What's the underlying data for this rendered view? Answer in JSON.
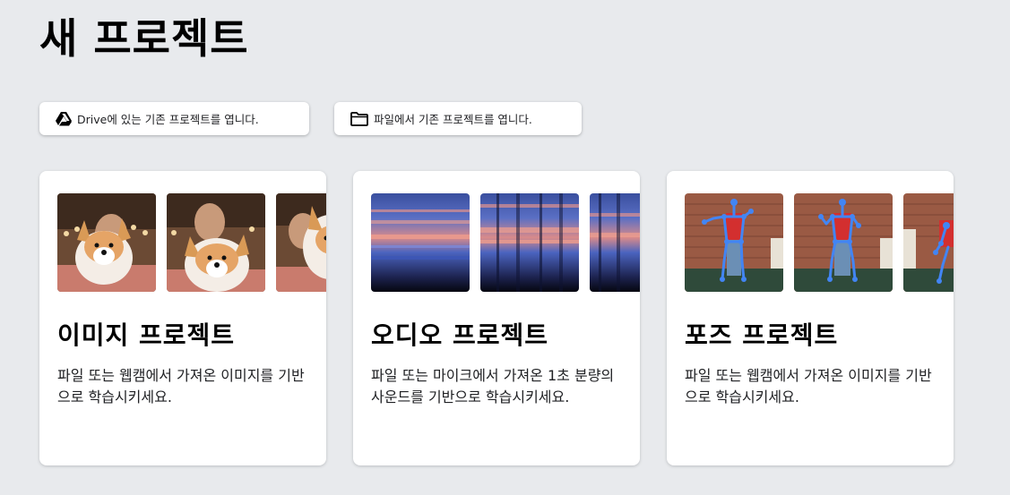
{
  "page": {
    "title": "새 프로젝트"
  },
  "open_buttons": {
    "drive": {
      "label": "Drive에 있는 기존 프로젝트를 엽니다.",
      "icon": "google-drive-icon"
    },
    "file": {
      "label": "파일에서 기존 프로젝트를 엽니다.",
      "icon": "folder-icon"
    }
  },
  "cards": [
    {
      "title": "이미지 프로젝트",
      "description": "파일 또는 웹캠에서 가져온 이미지를 기반으로 학습시키세요."
    },
    {
      "title": "오디오 프로젝트",
      "description": "파일 또는 마이크에서 가져온 1초 분량의 사운드를 기반으로 학습시키세요."
    },
    {
      "title": "포즈 프로젝트",
      "description": "파일 또는 웹캠에서 가져온 이미지를 기반으로 학습시키세요."
    }
  ],
  "colors": {
    "background": "#e8eaed",
    "card": "#ffffff",
    "pose_skeleton": "#4285f4"
  }
}
